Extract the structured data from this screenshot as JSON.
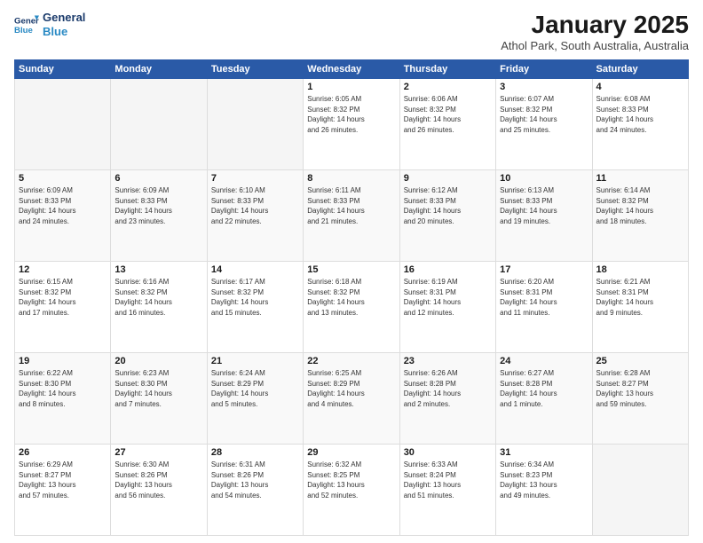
{
  "logo": {
    "line1": "General",
    "line2": "Blue"
  },
  "header": {
    "title": "January 2025",
    "subtitle": "Athol Park, South Australia, Australia"
  },
  "weekdays": [
    "Sunday",
    "Monday",
    "Tuesday",
    "Wednesday",
    "Thursday",
    "Friday",
    "Saturday"
  ],
  "weeks": [
    [
      {
        "day": "",
        "info": ""
      },
      {
        "day": "",
        "info": ""
      },
      {
        "day": "",
        "info": ""
      },
      {
        "day": "1",
        "info": "Sunrise: 6:05 AM\nSunset: 8:32 PM\nDaylight: 14 hours\nand 26 minutes."
      },
      {
        "day": "2",
        "info": "Sunrise: 6:06 AM\nSunset: 8:32 PM\nDaylight: 14 hours\nand 26 minutes."
      },
      {
        "day": "3",
        "info": "Sunrise: 6:07 AM\nSunset: 8:32 PM\nDaylight: 14 hours\nand 25 minutes."
      },
      {
        "day": "4",
        "info": "Sunrise: 6:08 AM\nSunset: 8:33 PM\nDaylight: 14 hours\nand 24 minutes."
      }
    ],
    [
      {
        "day": "5",
        "info": "Sunrise: 6:09 AM\nSunset: 8:33 PM\nDaylight: 14 hours\nand 24 minutes."
      },
      {
        "day": "6",
        "info": "Sunrise: 6:09 AM\nSunset: 8:33 PM\nDaylight: 14 hours\nand 23 minutes."
      },
      {
        "day": "7",
        "info": "Sunrise: 6:10 AM\nSunset: 8:33 PM\nDaylight: 14 hours\nand 22 minutes."
      },
      {
        "day": "8",
        "info": "Sunrise: 6:11 AM\nSunset: 8:33 PM\nDaylight: 14 hours\nand 21 minutes."
      },
      {
        "day": "9",
        "info": "Sunrise: 6:12 AM\nSunset: 8:33 PM\nDaylight: 14 hours\nand 20 minutes."
      },
      {
        "day": "10",
        "info": "Sunrise: 6:13 AM\nSunset: 8:33 PM\nDaylight: 14 hours\nand 19 minutes."
      },
      {
        "day": "11",
        "info": "Sunrise: 6:14 AM\nSunset: 8:32 PM\nDaylight: 14 hours\nand 18 minutes."
      }
    ],
    [
      {
        "day": "12",
        "info": "Sunrise: 6:15 AM\nSunset: 8:32 PM\nDaylight: 14 hours\nand 17 minutes."
      },
      {
        "day": "13",
        "info": "Sunrise: 6:16 AM\nSunset: 8:32 PM\nDaylight: 14 hours\nand 16 minutes."
      },
      {
        "day": "14",
        "info": "Sunrise: 6:17 AM\nSunset: 8:32 PM\nDaylight: 14 hours\nand 15 minutes."
      },
      {
        "day": "15",
        "info": "Sunrise: 6:18 AM\nSunset: 8:32 PM\nDaylight: 14 hours\nand 13 minutes."
      },
      {
        "day": "16",
        "info": "Sunrise: 6:19 AM\nSunset: 8:31 PM\nDaylight: 14 hours\nand 12 minutes."
      },
      {
        "day": "17",
        "info": "Sunrise: 6:20 AM\nSunset: 8:31 PM\nDaylight: 14 hours\nand 11 minutes."
      },
      {
        "day": "18",
        "info": "Sunrise: 6:21 AM\nSunset: 8:31 PM\nDaylight: 14 hours\nand 9 minutes."
      }
    ],
    [
      {
        "day": "19",
        "info": "Sunrise: 6:22 AM\nSunset: 8:30 PM\nDaylight: 14 hours\nand 8 minutes."
      },
      {
        "day": "20",
        "info": "Sunrise: 6:23 AM\nSunset: 8:30 PM\nDaylight: 14 hours\nand 7 minutes."
      },
      {
        "day": "21",
        "info": "Sunrise: 6:24 AM\nSunset: 8:29 PM\nDaylight: 14 hours\nand 5 minutes."
      },
      {
        "day": "22",
        "info": "Sunrise: 6:25 AM\nSunset: 8:29 PM\nDaylight: 14 hours\nand 4 minutes."
      },
      {
        "day": "23",
        "info": "Sunrise: 6:26 AM\nSunset: 8:28 PM\nDaylight: 14 hours\nand 2 minutes."
      },
      {
        "day": "24",
        "info": "Sunrise: 6:27 AM\nSunset: 8:28 PM\nDaylight: 14 hours\nand 1 minute."
      },
      {
        "day": "25",
        "info": "Sunrise: 6:28 AM\nSunset: 8:27 PM\nDaylight: 13 hours\nand 59 minutes."
      }
    ],
    [
      {
        "day": "26",
        "info": "Sunrise: 6:29 AM\nSunset: 8:27 PM\nDaylight: 13 hours\nand 57 minutes."
      },
      {
        "day": "27",
        "info": "Sunrise: 6:30 AM\nSunset: 8:26 PM\nDaylight: 13 hours\nand 56 minutes."
      },
      {
        "day": "28",
        "info": "Sunrise: 6:31 AM\nSunset: 8:26 PM\nDaylight: 13 hours\nand 54 minutes."
      },
      {
        "day": "29",
        "info": "Sunrise: 6:32 AM\nSunset: 8:25 PM\nDaylight: 13 hours\nand 52 minutes."
      },
      {
        "day": "30",
        "info": "Sunrise: 6:33 AM\nSunset: 8:24 PM\nDaylight: 13 hours\nand 51 minutes."
      },
      {
        "day": "31",
        "info": "Sunrise: 6:34 AM\nSunset: 8:23 PM\nDaylight: 13 hours\nand 49 minutes."
      },
      {
        "day": "",
        "info": ""
      }
    ]
  ]
}
